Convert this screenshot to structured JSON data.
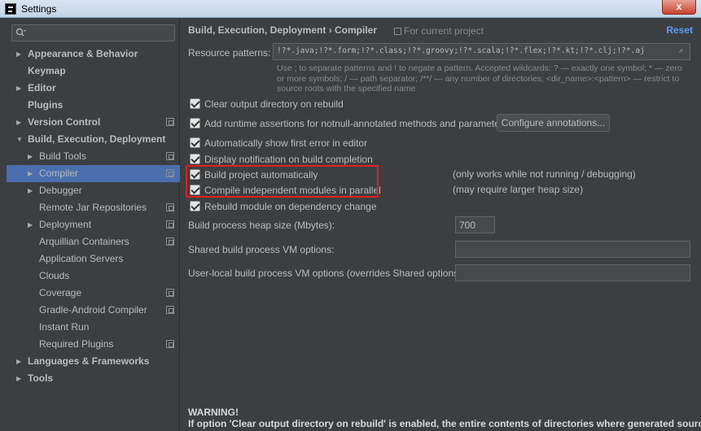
{
  "window": {
    "title": "Settings",
    "close_label": "x"
  },
  "sidebar": {
    "search_placeholder": "",
    "items": [
      {
        "label": "Appearance & Behavior",
        "expandable": true
      },
      {
        "label": "Keymap"
      },
      {
        "label": "Editor",
        "expandable": true
      },
      {
        "label": "Plugins"
      },
      {
        "label": "Version Control",
        "expandable": true
      },
      {
        "label": "Build, Execution, Deployment",
        "expanded": true
      },
      {
        "label": "Build Tools"
      },
      {
        "label": "Compiler"
      },
      {
        "label": "Debugger"
      },
      {
        "label": "Remote Jar Repositories"
      },
      {
        "label": "Deployment"
      },
      {
        "label": "Arquillian Containers"
      },
      {
        "label": "Application Servers"
      },
      {
        "label": "Clouds"
      },
      {
        "label": "Coverage"
      },
      {
        "label": "Gradle-Android Compiler"
      },
      {
        "label": "Instant Run"
      },
      {
        "label": "Required Plugins"
      },
      {
        "label": "Languages & Frameworks"
      },
      {
        "label": "Tools"
      }
    ]
  },
  "header": {
    "breadcrumb": "Build, Execution, Deployment  ›  Compiler",
    "scope": "For current project",
    "reset": "Reset"
  },
  "resource": {
    "label": "Resource patterns:",
    "value": "!?*.java;!?*.form;!?*.class;!?*.groovy;!?*.scala;!?*.flex;!?*.kt;!?*.clj;!?*.aj",
    "hint": "Use ; to separate patterns and ! to negate a pattern. Accepted wildcards: ? — exactly one symbol; * — zero or more symbols; / — path separator; /**/ — any number of directories; <dir_name>:<pattern> — restrict to source roots with the specified name"
  },
  "options": {
    "clear_output": "Clear output directory on rebuild",
    "runtime_assertions": "Add runtime assertions for notnull-annotated methods and parameters",
    "configure_annotations": "Configure annotations...",
    "show_first_error": "Automatically show first error in editor",
    "display_notification": "Display notification on build completion",
    "build_auto": "Build project automatically",
    "build_auto_note": "(only works while not running / debugging)",
    "compile_parallel": "Compile independent modules in parallel",
    "compile_parallel_note": "(may require larger heap size)",
    "rebuild_dependency": "Rebuild module on dependency change"
  },
  "fields": {
    "heap_label": "Build process heap size (Mbytes):",
    "heap_value": "700",
    "shared_vm_label": "Shared build process VM options:",
    "shared_vm_value": "",
    "user_vm_label": "User-local build process VM options (overrides Shared options):",
    "user_vm_value": ""
  },
  "warning": {
    "title": "WARNING!",
    "text": "If option 'Clear output directory on rebuild' is enabled, the entire contents of directories where generated sources are"
  },
  "colors": {
    "selection": "#4b6eaf",
    "link": "#589df6",
    "highlight": "#e02020",
    "background": "#3c3f41"
  }
}
